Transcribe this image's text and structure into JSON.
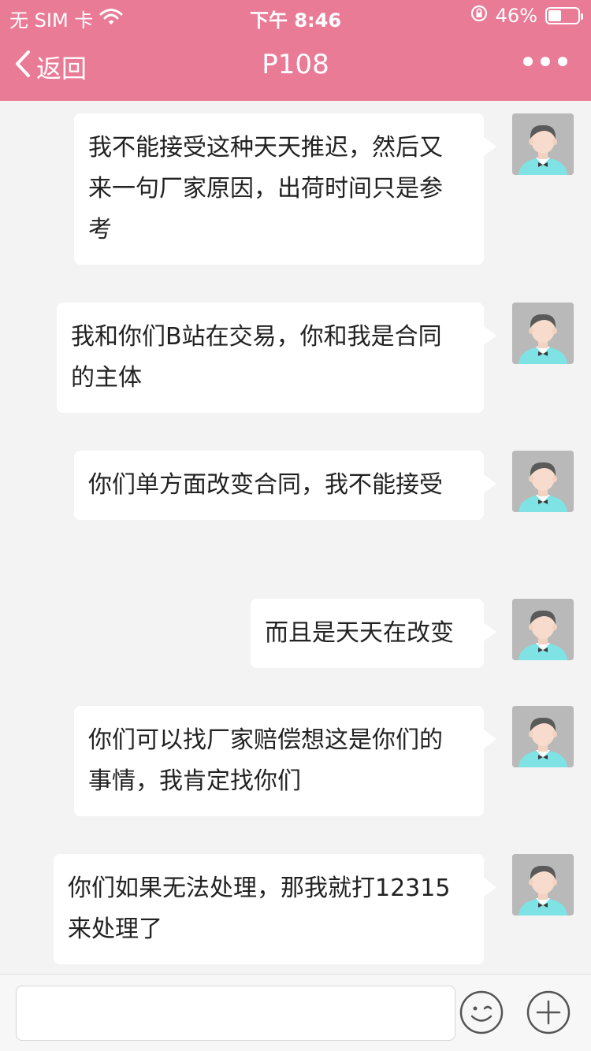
{
  "status_bar": {
    "carrier": "无 SIM 卡",
    "time": "下午 8:46",
    "battery": "46%"
  },
  "nav": {
    "back_label": "返回",
    "title": "P108"
  },
  "messages": [
    {
      "text": "我不能接受这种天天推迟，然后又来一句厂家原因，出荷时间只是参考"
    },
    {
      "text": "我和你们B站在交易，你和我是合同的主体"
    },
    {
      "text": "你们单方面改变合同，我不能接受"
    },
    {
      "text": "而且是天天在改变"
    },
    {
      "text": "你们可以找厂家赔偿想这是你们的事情，我肯定找你们"
    },
    {
      "text": "你们如果无法处理，那我就打12315来处理了"
    }
  ],
  "colors": {
    "header": "#ea7b96",
    "background": "#f3f3f3",
    "bubble": "#ffffff",
    "avatar_shirt": "#7fe3e6"
  }
}
